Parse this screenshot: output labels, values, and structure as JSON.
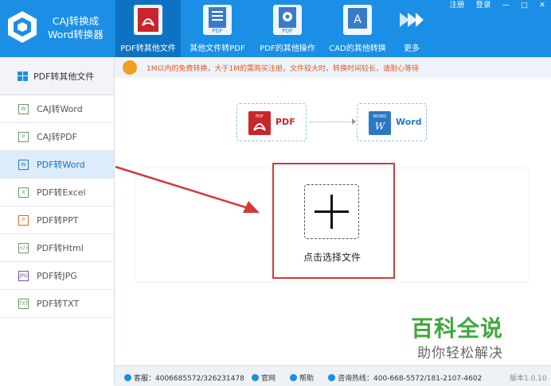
{
  "app": {
    "title_line1": "CAJ转换成",
    "title_line2": "Word转换器"
  },
  "nav": [
    {
      "label": "PDF转其他文件",
      "icon": "pdf-file-icon",
      "active": true
    },
    {
      "label": "其他文件转PDF",
      "icon": "doc-to-pdf-icon"
    },
    {
      "label": "PDF的其他操作",
      "icon": "pdf-gear-icon"
    },
    {
      "label": "CAD的其他转换",
      "icon": "cad-convert-icon"
    },
    {
      "label": "更多",
      "icon": "double-arrow-icon"
    }
  ],
  "window_controls": {
    "register": "注册",
    "login": "登录",
    "minimize": "—",
    "maximize": "□",
    "close": "✕"
  },
  "sidebar": {
    "header": "PDF转其他文件",
    "items": [
      {
        "label": "CAJ转Word",
        "icon_text": "W"
      },
      {
        "label": "CAJ转PDF",
        "icon_text": "P"
      },
      {
        "label": "PDF转Word",
        "icon_text": "W",
        "active": true
      },
      {
        "label": "PDF转Excel",
        "icon_text": "X"
      },
      {
        "label": "PDF转PPT",
        "icon_text": "P"
      },
      {
        "label": "PDF转Html",
        "icon_text": "</>"
      },
      {
        "label": "PDF转JPG",
        "icon_text": "JPG"
      },
      {
        "label": "PDF转TXT",
        "icon_text": "TXT"
      }
    ]
  },
  "notice": "1M以内的免费转换，大于1M的需购买注册，文件较大时，转换时间较长，请耐心等待",
  "conversion": {
    "from": "PDF",
    "to": "Word",
    "from_icon_text": "PDF",
    "to_icon_text": "WORD"
  },
  "upload": {
    "label": "点击选择文件"
  },
  "footer": {
    "qq": "客服：4006685572/326231478",
    "website": "官网",
    "help": "帮助",
    "hotline": "咨询热线：400-668-5572/181-2107-4602",
    "version": "版本1.0.10"
  },
  "watermark": {
    "line1": "百科全说",
    "line2": "助你轻松解决"
  },
  "colors": {
    "header_blue": "#1b8fe6",
    "active_nav": "#0e72c2",
    "pdf_red": "#c8262a",
    "word_blue": "#2b78c5",
    "highlight_red": "#d23a3a",
    "notice_orange": "#e0561c",
    "watermark_green": "#3fa83a"
  }
}
